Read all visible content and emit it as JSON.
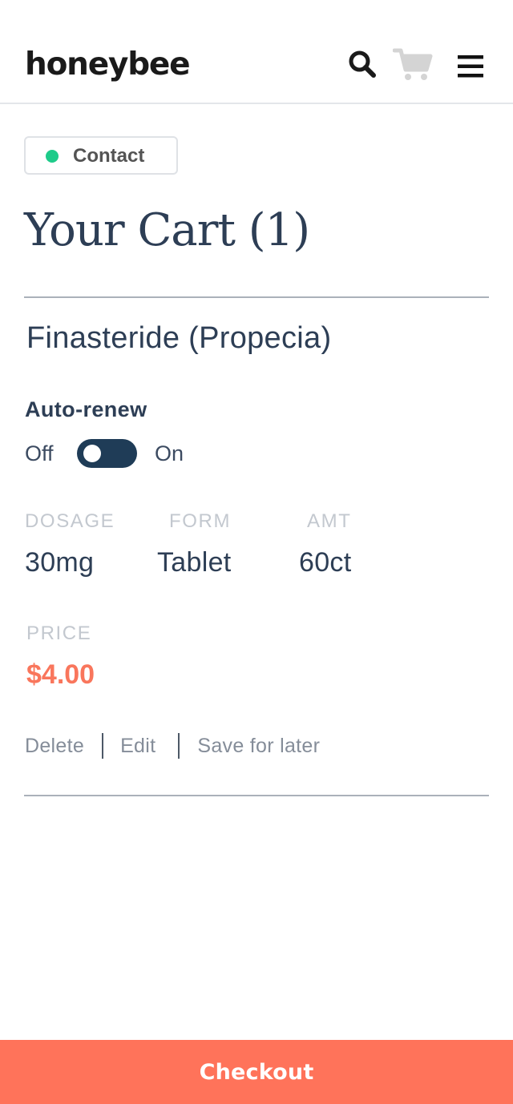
{
  "header": {
    "logo": "honeybee",
    "icons": {
      "search": "search-icon",
      "cart": "cart-icon",
      "menu": "hamburger-menu-icon"
    }
  },
  "contact": {
    "label": "Contact",
    "status_color": "#1ecb8a"
  },
  "cart": {
    "title": "Your Cart (1)"
  },
  "item": {
    "name": "Finasteride (Propecia)",
    "auto_renew": {
      "label": "Auto-renew",
      "off_label": "Off",
      "on_label": "On"
    },
    "specs": {
      "dosage_label": "DOSAGE",
      "dosage_value": "30mg",
      "form_label": "FORM",
      "form_value": "Tablet",
      "amt_label": "AMT",
      "amt_value": "60ct"
    },
    "price": {
      "label": "PRICE",
      "value": "$4.00"
    },
    "actions": {
      "delete": "Delete",
      "edit": "Edit",
      "save_for_later": "Save for later"
    }
  },
  "checkout": {
    "label": "Checkout"
  },
  "colors": {
    "accent": "#ff735a",
    "navy": "#2d3e55",
    "toggle_track": "#1f3c57"
  }
}
